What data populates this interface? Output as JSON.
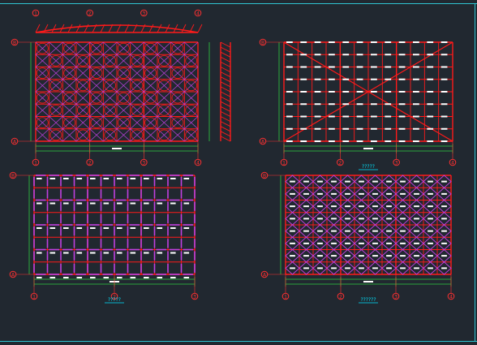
{
  "colors": {
    "background": "#212830",
    "frame": "#2fc4d2",
    "member": "#ff1a1a",
    "diagonal": "#c040e0",
    "dimension": "#2ecc40",
    "bubble": "#ff3030",
    "label": "#ffffff",
    "title": "#00e5ff"
  },
  "drawings": [
    {
      "id": "roof-elevation-plan",
      "position": "top-left",
      "grid_cols": [
        "1",
        "2",
        "3",
        "4"
      ],
      "grid_rows": [
        "B",
        "A"
      ],
      "title": "",
      "style": "space-truss-dense"
    },
    {
      "id": "roof-bracing-plan",
      "position": "top-right",
      "grid_cols": [
        "1",
        "2",
        "3",
        "4"
      ],
      "grid_rows": [
        "B",
        "A"
      ],
      "title": "?????",
      "style": "bracing-with-x"
    },
    {
      "id": "lower-chord-plan",
      "position": "bottom-left",
      "grid_cols": [
        "1",
        "2",
        "3"
      ],
      "grid_rows": [
        "B",
        "A"
      ],
      "title": "?????",
      "style": "chord-grid"
    },
    {
      "id": "web-member-plan",
      "position": "bottom-right",
      "grid_cols": [
        "1",
        "2",
        "3",
        "4"
      ],
      "grid_rows": [
        "B",
        "A"
      ],
      "title": "??????",
      "style": "web-diamonds"
    }
  ]
}
